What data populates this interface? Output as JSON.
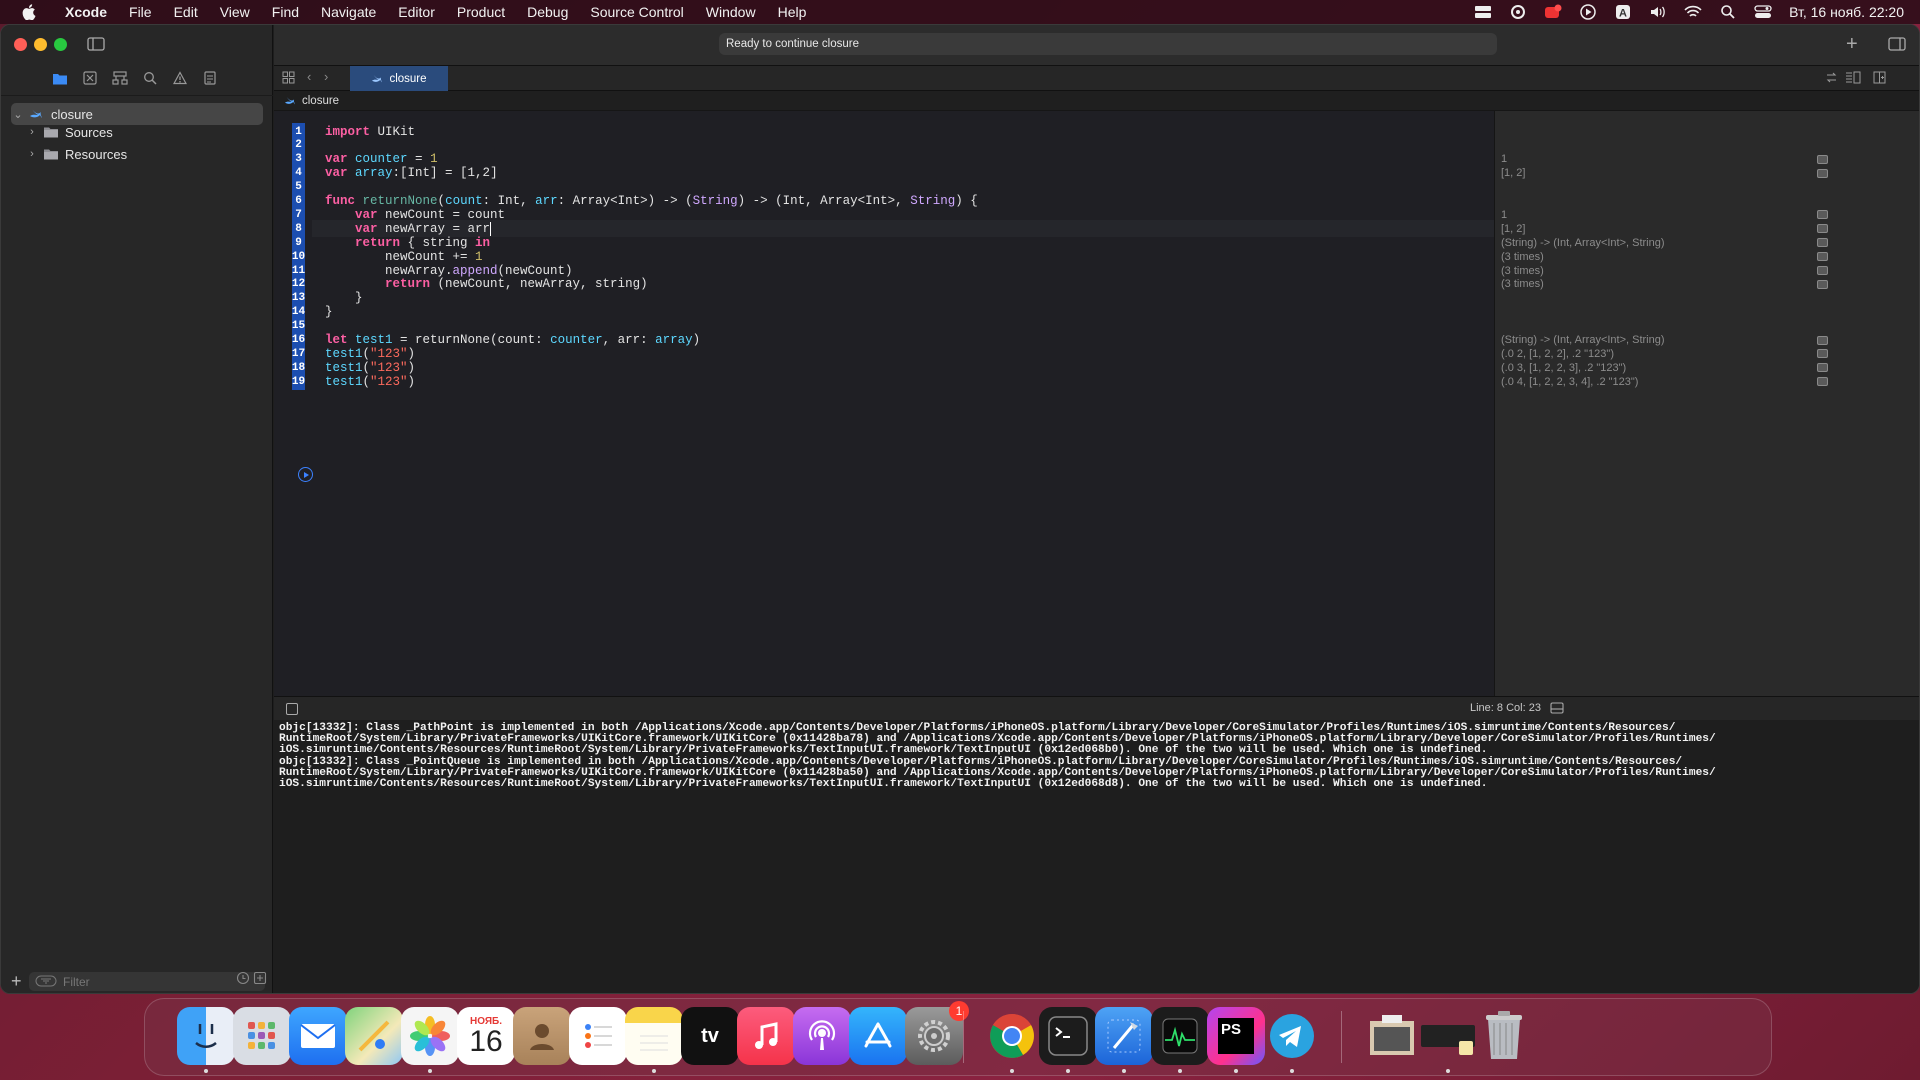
{
  "menubar": {
    "app": "Xcode",
    "items": [
      "File",
      "Edit",
      "View",
      "Find",
      "Navigate",
      "Editor",
      "Product",
      "Debug",
      "Source Control",
      "Window",
      "Help"
    ],
    "clock": "Вт, 16 нояб.  22:20",
    "icons": [
      "display-icon",
      "creative-cloud-icon",
      "notification-app-icon",
      "play-icon",
      "input-source-icon",
      "volume-icon",
      "wifi-icon",
      "spotlight-icon",
      "control-center-icon"
    ]
  },
  "toolbar": {
    "status": "Ready to continue closure"
  },
  "tab": {
    "label": "closure"
  },
  "jumpbar": {
    "file": "closure"
  },
  "navigator": {
    "items": [
      {
        "label": "closure"
      },
      {
        "label": "Sources"
      },
      {
        "label": "Resources"
      }
    ],
    "filter_placeholder": "Filter"
  },
  "editor": {
    "line_numbers": [
      "1",
      "2",
      "3",
      "4",
      "5",
      "6",
      "7",
      "8",
      "9",
      "10",
      "11",
      "12",
      "13",
      "14",
      "15",
      "16",
      "17",
      "18",
      "19"
    ],
    "current_line": 8,
    "lines": [
      [
        [
          "kw",
          "import"
        ],
        [
          "pl",
          " UIKit"
        ]
      ],
      [],
      [
        [
          "kw",
          "var"
        ],
        [
          "pl",
          " "
        ],
        [
          "pr",
          "counter"
        ],
        [
          "pl",
          " = "
        ],
        [
          "nm",
          "1"
        ]
      ],
      [
        [
          "kw",
          "var"
        ],
        [
          "pl",
          " "
        ],
        [
          "pr",
          "array"
        ],
        [
          "pl",
          ":[Int] = [1,2]"
        ]
      ],
      [],
      [
        [
          "kw",
          "func"
        ],
        [
          "pl",
          " "
        ],
        [
          "fn",
          "returnNone"
        ],
        [
          "pl",
          "("
        ],
        [
          "pr",
          "count"
        ],
        [
          "pl",
          ": Int, "
        ],
        [
          "pr",
          "arr"
        ],
        [
          "pl",
          ": Array<Int>) -> ("
        ],
        [
          "ty",
          "String"
        ],
        [
          "pl",
          ") -> (Int, Array<Int>, "
        ],
        [
          "ty",
          "String"
        ],
        [
          "pl",
          ") {"
        ]
      ],
      [
        [
          "pl",
          "    "
        ],
        [
          "kw",
          "var"
        ],
        [
          "pl",
          " newCount = count"
        ]
      ],
      [
        [
          "pl",
          "    "
        ],
        [
          "kw",
          "var"
        ],
        [
          "pl",
          " newArray = arr"
        ]
      ],
      [
        [
          "pl",
          "    "
        ],
        [
          "kw",
          "return"
        ],
        [
          "pl",
          " { string "
        ],
        [
          "kw",
          "in"
        ]
      ],
      [
        [
          "pl",
          "        newCount += "
        ],
        [
          "nm",
          "1"
        ]
      ],
      [
        [
          "pl",
          "        newArray."
        ],
        [
          "ty",
          "append"
        ],
        [
          "pl",
          "(newCount)"
        ]
      ],
      [
        [
          "pl",
          "        "
        ],
        [
          "kw",
          "return"
        ],
        [
          "pl",
          " (newCount, newArray, string)"
        ]
      ],
      [
        [
          "pl",
          "    }"
        ]
      ],
      [
        [
          "pl",
          "}"
        ]
      ],
      [],
      [
        [
          "kw",
          "let"
        ],
        [
          "pl",
          " "
        ],
        [
          "pr",
          "test1"
        ],
        [
          "pl",
          " = returnNone(count: "
        ],
        [
          "pr",
          "counter"
        ],
        [
          "pl",
          ", arr: "
        ],
        [
          "pr",
          "array"
        ],
        [
          "pl",
          ")"
        ]
      ],
      [
        [
          "pr",
          "test1"
        ],
        [
          "pl",
          "("
        ],
        [
          "st",
          "\"123\""
        ],
        [
          "pl",
          ")"
        ]
      ],
      [
        [
          "pr",
          "test1"
        ],
        [
          "pl",
          "("
        ],
        [
          "st",
          "\"123\""
        ],
        [
          "pl",
          ")"
        ]
      ],
      [
        [
          "pr",
          "test1"
        ],
        [
          "pl",
          "("
        ],
        [
          "st",
          "\"123\""
        ],
        [
          "pl",
          ")"
        ]
      ]
    ]
  },
  "results": [
    {
      "line": 3,
      "text": "1"
    },
    {
      "line": 4,
      "text": "[1, 2]"
    },
    {
      "line": 7,
      "text": "1"
    },
    {
      "line": 8,
      "text": "[1, 2]"
    },
    {
      "line": 9,
      "text": "(String) -> (Int, Array<Int>, String)"
    },
    {
      "line": 10,
      "text": "(3 times)"
    },
    {
      "line": 11,
      "text": "(3 times)"
    },
    {
      "line": 12,
      "text": "(3 times)"
    },
    {
      "line": 16,
      "text": "(String) -> (Int, Array<Int>, String)"
    },
    {
      "line": 17,
      "text": "(.0 2, [1, 2, 2], .2 \"123\")"
    },
    {
      "line": 18,
      "text": "(.0 3, [1, 2, 2, 3], .2 \"123\")"
    },
    {
      "line": 19,
      "text": "(.0 4, [1, 2, 2, 3, 4], .2 \"123\")"
    }
  ],
  "debug": {
    "line_col": "Line: 8  Col: 23",
    "console": [
      "objc[13332]: Class _PathPoint is implemented in both /Applications/Xcode.app/Contents/Developer/Platforms/iPhoneOS.platform/Library/Developer/CoreSimulator/Profiles/Runtimes/iOS.simruntime/Contents/Resources/",
      "RuntimeRoot/System/Library/PrivateFrameworks/UIKitCore.framework/UIKitCore (0x11428ba78) and /Applications/Xcode.app/Contents/Developer/Platforms/iPhoneOS.platform/Library/Developer/CoreSimulator/Profiles/Runtimes/",
      "iOS.simruntime/Contents/Resources/RuntimeRoot/System/Library/PrivateFrameworks/TextInputUI.framework/TextInputUI (0x12ed068b0). One of the two will be used. Which one is undefined.",
      "objc[13332]: Class _PointQueue is implemented in both /Applications/Xcode.app/Contents/Developer/Platforms/iPhoneOS.platform/Library/Developer/CoreSimulator/Profiles/Runtimes/iOS.simruntime/Contents/Resources/",
      "RuntimeRoot/System/Library/PrivateFrameworks/UIKitCore.framework/UIKitCore (0x11428ba50) and /Applications/Xcode.app/Contents/Developer/Platforms/iPhoneOS.platform/Library/Developer/CoreSimulator/Profiles/Runtimes/",
      "iOS.simruntime/Contents/Resources/RuntimeRoot/System/Library/PrivateFrameworks/TextInputUI.framework/TextInputUI (0x12ed068d8). One of the two will be used. Which one is undefined."
    ]
  },
  "dock": {
    "apps": [
      "finder",
      "launchpad",
      "mail",
      "maps",
      "photos",
      "calendar",
      "contacts",
      "reminders",
      "notes",
      "apple-tv",
      "music",
      "podcasts",
      "app-store",
      "system-preferences",
      "chrome",
      "terminal",
      "xcode",
      "activity-monitor",
      "phpstorm",
      "telegram"
    ],
    "calendar_month": "НОЯБ.",
    "calendar_day": "16",
    "settings_badge": "1",
    "tv_label": "tv",
    "ps_label": "PS"
  },
  "colors": {
    "accent": "#2a4b7c",
    "line_number_bg": "#1c4eb0",
    "keyword": "#fc5fa3",
    "string": "#fc6a5d",
    "number": "#d0bf69"
  }
}
